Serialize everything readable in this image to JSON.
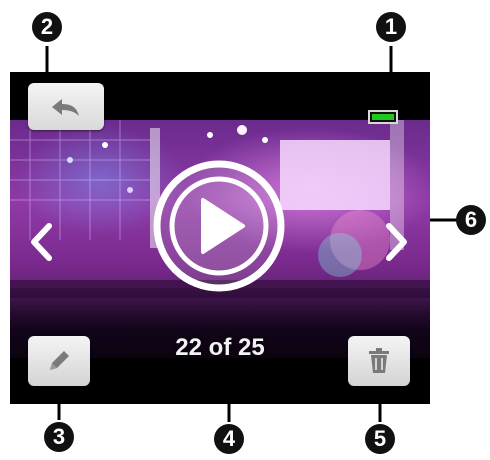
{
  "screen": {
    "counter_text": "22 of 25",
    "battery": {
      "level": 1.0,
      "color": "#1fc71f"
    }
  },
  "buttons": {
    "back_icon": "back-arrow-icon",
    "edit_icon": "pencil-icon",
    "delete_icon": "trash-icon",
    "play_icon": "play-icon",
    "prev_icon": "chevron-left-icon",
    "next_icon": "chevron-right-icon"
  },
  "callouts": {
    "c1": "1",
    "c2": "2",
    "c3": "3",
    "c4": "4",
    "c5": "5",
    "c6": "6"
  }
}
